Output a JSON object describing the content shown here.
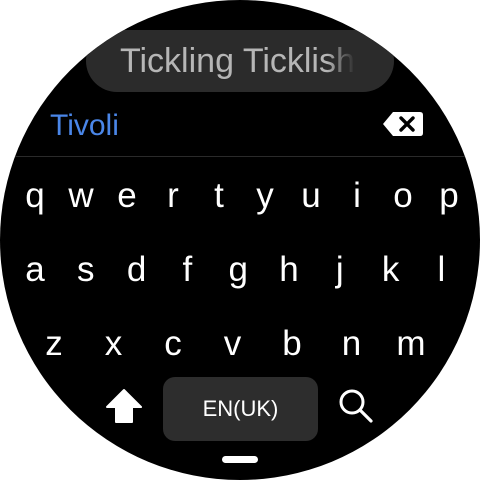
{
  "suggestion": {
    "text": "Tickling Ticklish"
  },
  "input": {
    "typed_text": "Tivoli",
    "color": "#4a86e8"
  },
  "keyboard": {
    "rows": [
      [
        "q",
        "w",
        "e",
        "r",
        "t",
        "y",
        "u",
        "i",
        "o",
        "p"
      ],
      [
        "a",
        "s",
        "d",
        "f",
        "g",
        "h",
        "j",
        "k",
        "l"
      ],
      [
        "z",
        "x",
        "c",
        "v",
        "b",
        "n",
        "m"
      ]
    ],
    "language_label": "EN(UK)"
  },
  "icons": {
    "backspace": "backspace-icon",
    "shift": "shift-arrow-icon",
    "search": "search-icon"
  }
}
